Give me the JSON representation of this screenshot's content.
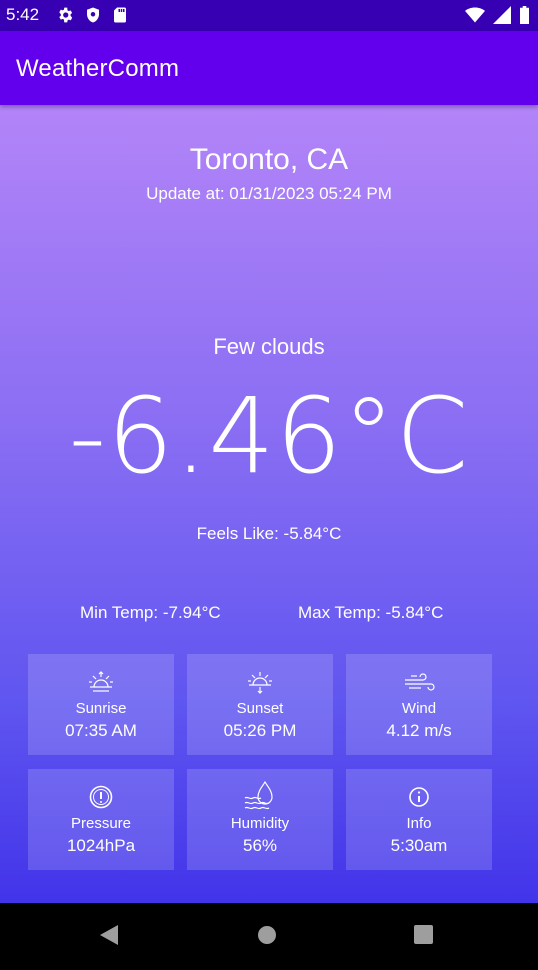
{
  "status_bar": {
    "time": "5:42",
    "left_icons": [
      "gear-icon",
      "shield-icon",
      "sd-card-icon"
    ],
    "right_icons": [
      "wifi-icon",
      "signal-icon",
      "battery-icon"
    ]
  },
  "app_bar": {
    "title": "WeatherComm"
  },
  "weather": {
    "city": "Toronto, CA",
    "updated": "Update at: 01/31/2023 05:24 PM",
    "description": "Few clouds",
    "temperature": "-6.46°C",
    "feels_like": "Feels Like: -5.84°C",
    "min_temp": "Min Temp: -7.94°C",
    "max_temp": "Max Temp: -5.84°C"
  },
  "cards": [
    {
      "icon": "sunrise-icon",
      "label": "Sunrise",
      "value": "07:35 AM"
    },
    {
      "icon": "sunset-icon",
      "label": "Sunset",
      "value": "05:26 PM"
    },
    {
      "icon": "wind-icon",
      "label": "Wind",
      "value": "4.12 m/s"
    },
    {
      "icon": "pressure-icon",
      "label": "Pressure",
      "value": "1024hPa"
    },
    {
      "icon": "humidity-icon",
      "label": "Humidity",
      "value": "56%"
    },
    {
      "icon": "info-icon",
      "label": "Info",
      "value": "5:30am"
    }
  ],
  "nav_bar": {
    "icons": [
      "back-icon",
      "home-icon",
      "recents-icon"
    ]
  },
  "colors": {
    "status_bar": "#3700b3",
    "app_bar": "#6200ee",
    "gradient_top": "#b384f8",
    "gradient_bottom": "#4234e9"
  }
}
